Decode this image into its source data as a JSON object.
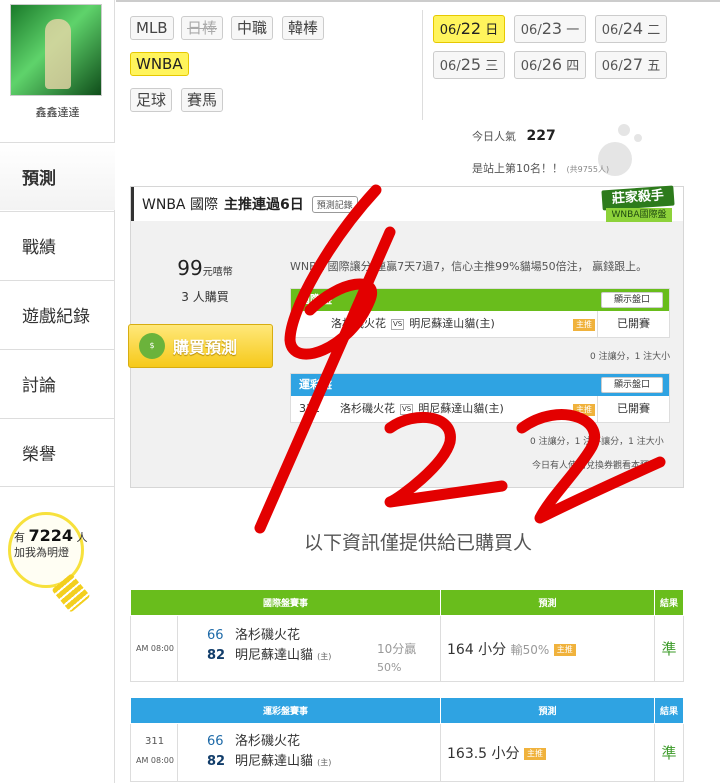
{
  "user": {
    "name": "鑫鑫達達"
  },
  "nav": [
    {
      "label": "預測",
      "active": true
    },
    {
      "label": "戰績"
    },
    {
      "label": "遊戲紀錄"
    },
    {
      "label": "討論"
    },
    {
      "label": "榮譽"
    }
  ],
  "fans": {
    "prefix": "有",
    "count": "7224",
    "unit": "人",
    "suffix": "加我為明燈"
  },
  "leagues": [
    "MLB",
    "日棒",
    "中職",
    "韓棒",
    "WNBA",
    "足球",
    "賽馬"
  ],
  "dates": [
    {
      "d": "06/",
      "n": "22",
      "w": "日",
      "selected": true
    },
    {
      "d": "06/",
      "n": "23",
      "w": "一"
    },
    {
      "d": "06/",
      "n": "24",
      "w": "二"
    },
    {
      "d": "06/",
      "n": "25",
      "w": "三"
    },
    {
      "d": "06/",
      "n": "26",
      "w": "四"
    },
    {
      "d": "06/",
      "n": "27",
      "w": "五"
    }
  ],
  "popularity": {
    "label": "今日人氣",
    "value": "227",
    "rank_text": "是站上第10名！！",
    "rank_total": "(共9755人)"
  },
  "card": {
    "league": "WNBA 國際",
    "headline": "主推連過6日",
    "record_btn": "預測記錄",
    "badge_top": "莊家殺手",
    "badge_bottom": "WNBA國際盤",
    "price": "99",
    "price_unit": "元嘻幣",
    "buyers": "3",
    "buyers_unit": "人購買",
    "buy_label": "購買預測",
    "desc": "WNBA 國際讓分 連贏7天7過7，信心主推99%貓場50倍注， 贏錢跟上。",
    "intl_title": "國際盤",
    "show_btn": "顯示盤口",
    "intl_away": "洛杉磯火花",
    "intl_home": "明尼蘇達山貓(主)",
    "main_tag": "主推",
    "status": "已開賽",
    "intl_note": "0 注讓分，1 注大小",
    "lot_title": "運彩盤",
    "lot_num": "311",
    "lot_away": "洛杉磯火花",
    "lot_home": "明尼蘇達山貓(主)",
    "lot_note": "0 注讓分，1 注不讓分，1 注大小",
    "today_note": "今日有人使用兌換券觀看本預測"
  },
  "scrawl": "6/22",
  "info_text": "以下資訊僅提供給已購買人",
  "intl_table": {
    "headers": [
      "國際盤賽事",
      "預測",
      "結果"
    ],
    "time": "AM 08:00",
    "away_score": "66",
    "away": "洛杉磯火花",
    "home_score": "82",
    "home": "明尼蘇達山貓",
    "home_mark": "(主)",
    "spread": "10分贏",
    "spread_pct": "50%",
    "pick": "164 小分",
    "pick_extra": "輸50%",
    "tag": "主推",
    "result": "準"
  },
  "lot_table": {
    "headers": [
      "運彩盤賽事",
      "預測",
      "結果"
    ],
    "num": "311",
    "time": "AM 08:00",
    "away_score": "66",
    "away": "洛杉磯火花",
    "home_score": "82",
    "home": "明尼蘇達山貓",
    "home_mark": "(主)",
    "pick": "163.5 小分",
    "tag": "主推",
    "result": "準"
  },
  "colors": {
    "intl": "#69bd1c",
    "lottery": "#2fa3e2",
    "selected": "#fff45c",
    "ink": "#e30000"
  }
}
